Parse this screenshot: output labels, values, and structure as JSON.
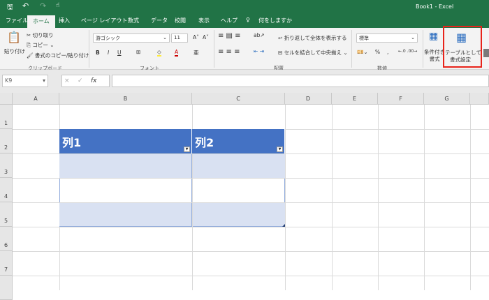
{
  "window": {
    "title": "Book1  -  Excel"
  },
  "qat": {
    "save": "save-icon",
    "undo": "undo-icon",
    "redo": "redo-icon",
    "touch": "touch-mode-icon"
  },
  "tabs": [
    "ファイル",
    "ホーム",
    "挿入",
    "ページ レイアウト",
    "数式",
    "データ",
    "校閲",
    "表示",
    "ヘルプ"
  ],
  "tell_me": "何をしますか",
  "ribbon": {
    "clipboard": {
      "paste": "貼り付け",
      "cut": "切り取り",
      "copy": "コピー",
      "format_painter": "書式のコピー/貼り付け",
      "label": "クリップボード"
    },
    "font": {
      "name": "游ゴシック",
      "size": "11",
      "bold": "B",
      "italic": "I",
      "underline": "U",
      "label": "フォント"
    },
    "alignment": {
      "wrap": "折り返して全体を表示する",
      "merge": "セルを結合して中央揃え",
      "label": "配置"
    },
    "number": {
      "format": "標準",
      "percent": "%",
      "comma": ",",
      "label": "数値"
    },
    "styles": {
      "conditional": "条件付き\n書式",
      "table_format_line1": "テーブルとして",
      "table_format_line2": "書式設定",
      "highlight_color": "#e8231a"
    }
  },
  "formula_bar": {
    "name_box": "K9",
    "cancel": "×",
    "enter": "✓",
    "fx": "fx",
    "value": ""
  },
  "columns": [
    "A",
    "B",
    "C",
    "D",
    "E",
    "F",
    "G"
  ],
  "rows": [
    "1",
    "2",
    "3",
    "4",
    "5",
    "6",
    "7"
  ],
  "table": {
    "headers": [
      "列1",
      "列2"
    ],
    "header_color": "#4472c4",
    "band_color": "#d9e1f2"
  }
}
